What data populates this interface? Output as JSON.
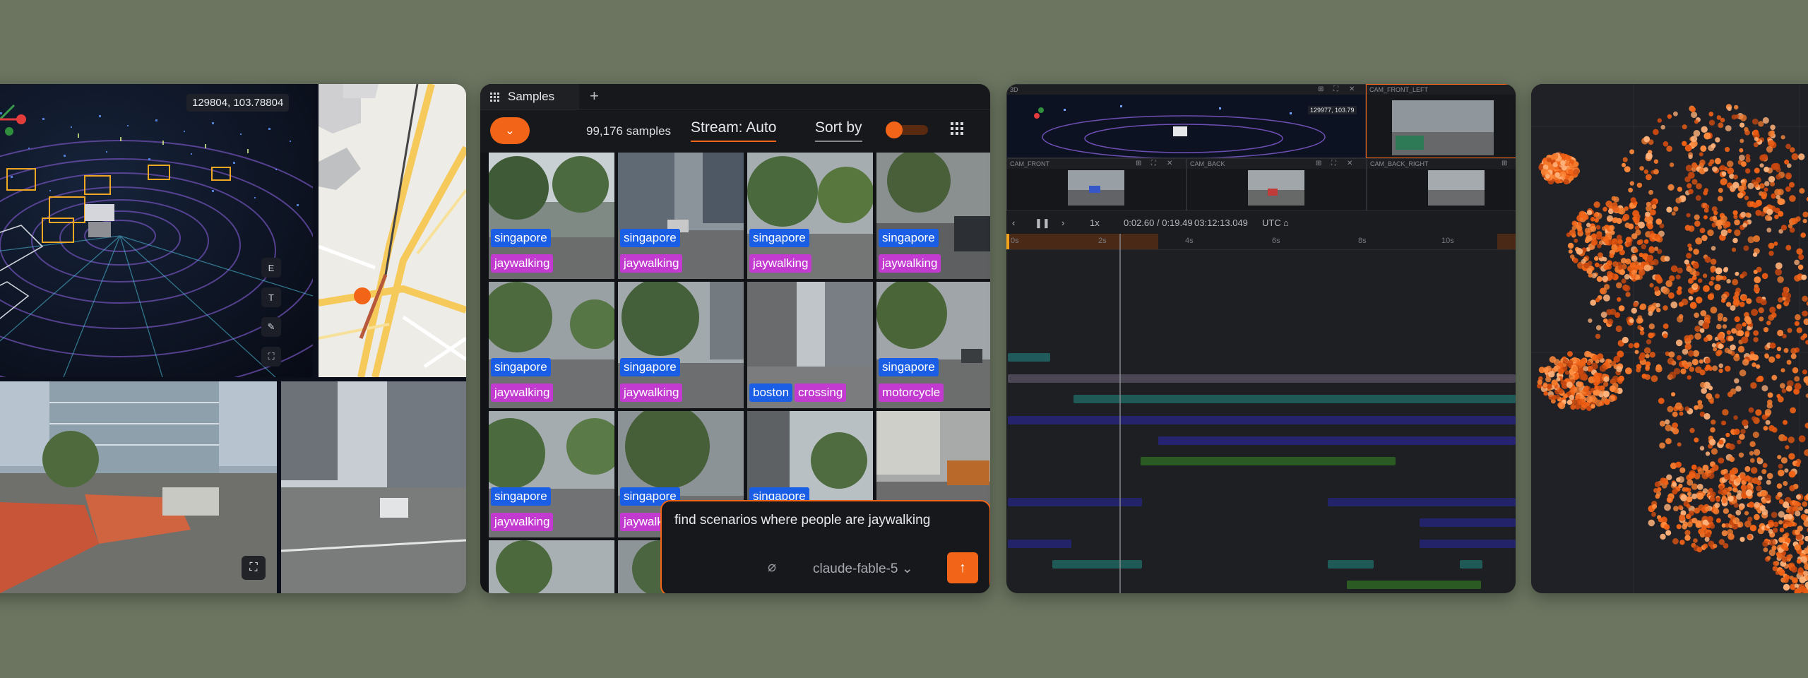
{
  "colors": {
    "accent": "#f26417",
    "location_tag": "#1a5ee6",
    "label_tag": "#c33ad1",
    "background": "#6b7560"
  },
  "viewer3d": {
    "coordinates": "129804, 103.78804",
    "tools": [
      {
        "icon": "E"
      },
      {
        "icon": "T"
      },
      {
        "icon": "ruler-icon"
      },
      {
        "icon": "fullscreen-icon"
      }
    ]
  },
  "samples": {
    "tab_label": "Samples",
    "count_text": "99,176 samples",
    "stream_label": "Stream: Auto",
    "sort_label": "Sort by",
    "rows": [
      [
        {
          "location": "singapore",
          "label": "jaywalking"
        },
        {
          "location": "singapore",
          "label": "jaywalking"
        },
        {
          "location": "singapore",
          "label": "jaywalking"
        },
        {
          "location": "singapore",
          "label": "jaywalking"
        }
      ],
      [
        {
          "location": "singapore",
          "label": "jaywalking"
        },
        {
          "location": "singapore",
          "label": "jaywalking"
        },
        {
          "location": "boston",
          "label": "crossing"
        },
        {
          "location": "singapore",
          "label": "motorcycle"
        }
      ],
      [
        {
          "location": "singapore",
          "label": "jaywalking"
        },
        {
          "location": "singapore",
          "label": "jaywalking"
        },
        {
          "location": "singapore",
          "label": ""
        },
        {
          "location": "",
          "label": ""
        }
      ]
    ],
    "chat": {
      "query": "find scenarios where people are jaywalking",
      "model": "claude-fable-5"
    }
  },
  "timeline": {
    "panes": {
      "p3d": "3D",
      "front_left": "CAM_FRONT_LEFT",
      "front": "CAM_FRONT",
      "back": "CAM_BACK",
      "back_right": "CAM_BACK_RIGHT"
    },
    "mini_coord": "129977, 103.79",
    "speed": "1x",
    "time": "0:02.60 / 0:19.49",
    "clock": "03:12:13.049",
    "tz": "UTC",
    "ruler": [
      "0s",
      "2s",
      "4s",
      "6s",
      "8s",
      "10s"
    ]
  }
}
